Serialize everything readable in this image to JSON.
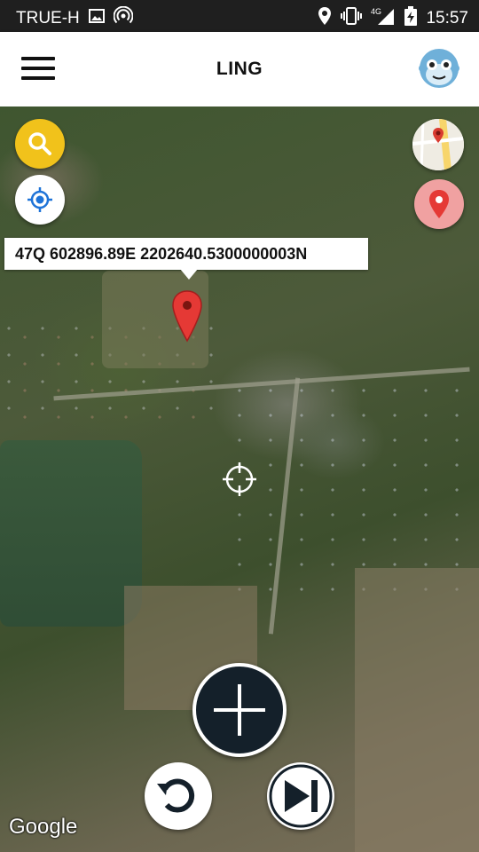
{
  "status_bar": {
    "carrier": "TRUE-H",
    "network": "4G",
    "time": "15:57",
    "icons": [
      "image-icon",
      "hotspot-icon",
      "location-icon",
      "vibrate-icon",
      "signal-icon",
      "battery-charging-icon"
    ]
  },
  "app_bar": {
    "title": "LING",
    "menu_icon": "hamburger-menu-icon",
    "avatar_icon": "monkey-avatar-icon"
  },
  "map": {
    "coordinate_label": "47Q 602896.89E 2202640.5300000003N",
    "attribution": "Google",
    "controls": [
      "search-icon",
      "my-location-icon",
      "street-map-icon",
      "pin-icon",
      "crosshair-icon",
      "plus-icon",
      "undo-icon",
      "skip-next-icon"
    ]
  },
  "colors": {
    "search_fab": "#f1c21b",
    "pin_fab": "#f0a1a1",
    "add_button": "#14202a",
    "marker": "#e53935",
    "locate_blue": "#1e73d8"
  }
}
